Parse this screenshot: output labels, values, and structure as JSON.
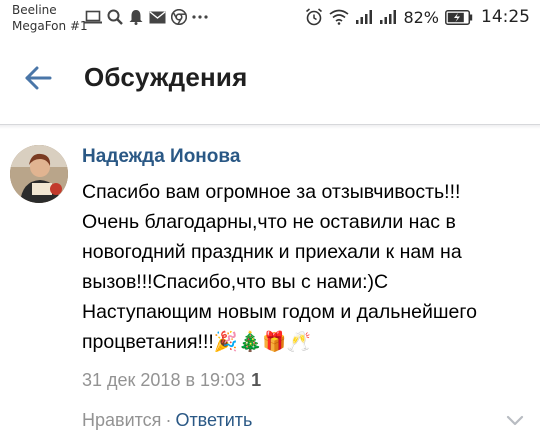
{
  "status_bar": {
    "carrier_line1": "Beeline",
    "carrier_line2": "MegaFon #1",
    "left_icons": [
      "laptop-icon",
      "search-icon",
      "bell-icon",
      "mail-icon",
      "chrome-icon",
      "more-icon"
    ],
    "right_icons": [
      "alarm-icon",
      "wifi-icon",
      "signal-icon",
      "signal-icon-2",
      "battery-icon"
    ],
    "battery": "82%",
    "time": "14:25"
  },
  "toolbar": {
    "title": "Обсуждения",
    "back_icon": "arrow-left-icon",
    "accent": "#4a76a8"
  },
  "comment": {
    "author": "Надежда Ионова",
    "text": "Спасибо вам огромное за отзывчивость!!!\nОчень благодарны,что не оставили нас в\nновогодний праздник и приехали к нам на\nвызов!!!Спасибо,что вы с нами:)С\nНаступающим новым годом и дальнейшего\nпроцветания!!!🎉🎄🎁🥂",
    "date": "31 дек 2018 в 19:03",
    "reply_count": "1",
    "like_label": "Нравится",
    "separator": "·",
    "reply_label": "Ответить",
    "link_color": "#2a5885",
    "meta_color": "#939393"
  }
}
